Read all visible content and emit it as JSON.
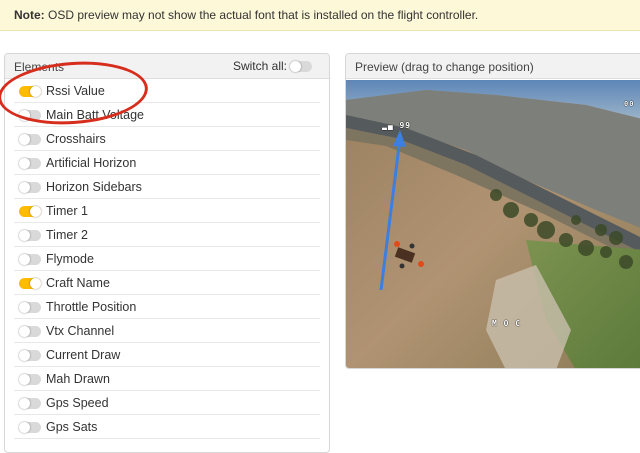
{
  "note": {
    "label": "Note:",
    "text": " OSD preview may not show the actual font that is installed on the flight controller."
  },
  "elements_panel": {
    "title": "Elements",
    "switch_all_label": "Switch all:",
    "switch_all_on": false,
    "items": [
      {
        "label": "Rssi Value",
        "on": true
      },
      {
        "label": "Main Batt Voltage",
        "on": false
      },
      {
        "label": "Crosshairs",
        "on": false
      },
      {
        "label": "Artificial Horizon",
        "on": false
      },
      {
        "label": "Horizon Sidebars",
        "on": false
      },
      {
        "label": "Timer 1",
        "on": true
      },
      {
        "label": "Timer 2",
        "on": false
      },
      {
        "label": "Flymode",
        "on": false
      },
      {
        "label": "Craft Name",
        "on": true
      },
      {
        "label": "Throttle Position",
        "on": false
      },
      {
        "label": "Vtx Channel",
        "on": false
      },
      {
        "label": "Current Draw",
        "on": false
      },
      {
        "label": "Mah Drawn",
        "on": false
      },
      {
        "label": "Gps Speed",
        "on": false
      },
      {
        "label": "Gps Sats",
        "on": false
      }
    ]
  },
  "preview": {
    "title": "Preview (drag to change position)",
    "osd_rssi": "99",
    "osd_timer": "00",
    "osd_craft": "M O C"
  },
  "colors": {
    "toggle_on": "#ffbb00",
    "toggle_off": "#d9d9d9",
    "annotation_red": "#d62d1c",
    "arrow_blue": "#3b7fe0"
  }
}
